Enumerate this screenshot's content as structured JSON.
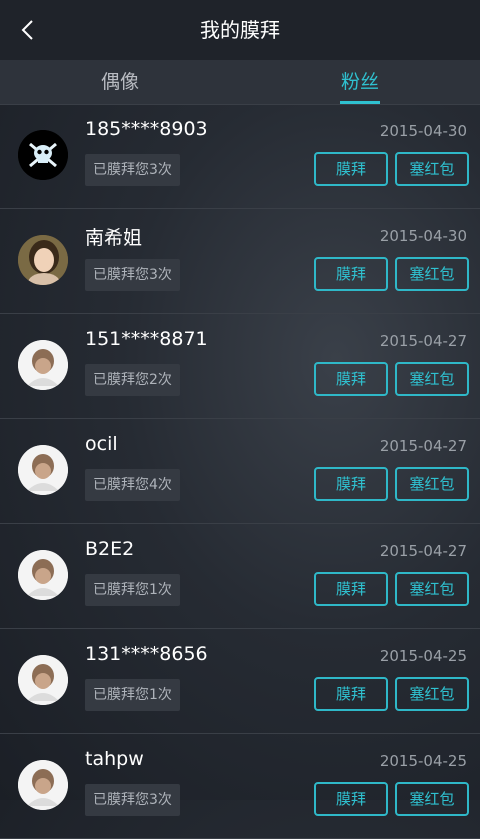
{
  "header": {
    "title": "我的膜拜",
    "back_icon": "back-chevron-icon"
  },
  "tabs": [
    {
      "label": "偶像",
      "active": false
    },
    {
      "label": "粉丝",
      "active": true
    }
  ],
  "accent_color": "#2fc1d0",
  "buttons": {
    "worship": "膜拜",
    "red_packet": "塞红包"
  },
  "fans": [
    {
      "name": "185****8903",
      "date": "2015-04-30",
      "count_text": "已膜拜您3次",
      "avatar": "pirate-skull-avatar"
    },
    {
      "name": "南希姐",
      "date": "2015-04-30",
      "count_text": "已膜拜您3次",
      "avatar": "photo-avatar"
    },
    {
      "name": "151****8871",
      "date": "2015-04-27",
      "count_text": "已膜拜您2次",
      "avatar": "default-avatar"
    },
    {
      "name": "ocil",
      "date": "2015-04-27",
      "count_text": "已膜拜您4次",
      "avatar": "default-avatar"
    },
    {
      "name": "B2E2",
      "date": "2015-04-27",
      "count_text": "已膜拜您1次",
      "avatar": "default-avatar"
    },
    {
      "name": "131****8656",
      "date": "2015-04-25",
      "count_text": "已膜拜您1次",
      "avatar": "default-avatar"
    },
    {
      "name": "tahpw",
      "date": "2015-04-25",
      "count_text": "已膜拜您3次",
      "avatar": "default-avatar"
    }
  ]
}
